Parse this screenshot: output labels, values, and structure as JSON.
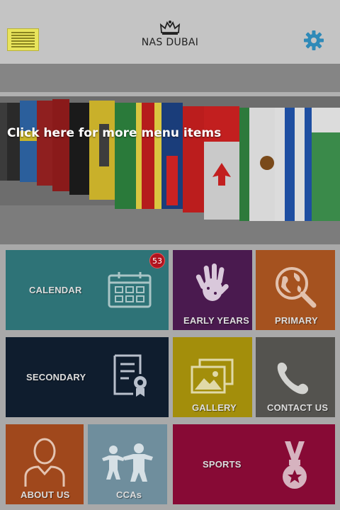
{
  "header": {
    "logo_text": "NAS DUBAI",
    "menu_icon": "hamburger-icon",
    "settings_icon": "gear-icon",
    "settings_color": "#2f8ab8"
  },
  "hero": {
    "hint": "Click here for more menu items"
  },
  "tiles": {
    "calendar": {
      "label": "CALENDAR",
      "badge": "53",
      "color": "#2e7377",
      "icon": "calendar-icon"
    },
    "early_years": {
      "label": "EARLY YEARS",
      "color": "#4a1a4f",
      "icon": "handprint-icon"
    },
    "primary": {
      "label": "PRIMARY",
      "color": "#a5521f",
      "icon": "globe-magnifier-icon"
    },
    "secondary": {
      "label": "SECONDARY",
      "color": "#0f1d2e",
      "icon": "certificate-icon"
    },
    "gallery": {
      "label": "GALLERY",
      "color": "#a38e0b",
      "icon": "images-icon"
    },
    "contact_us": {
      "label": "CONTACT US",
      "color": "#54534f",
      "icon": "phone-icon"
    },
    "about_us": {
      "label": "ABOUT US",
      "color": "#a0481c",
      "icon": "person-icon"
    },
    "ccas": {
      "label": "CCAs",
      "color": "#6f8e9d",
      "icon": "people-icon"
    },
    "sports": {
      "label": "SPORTS",
      "color": "#870a35",
      "icon": "medal-icon"
    }
  }
}
